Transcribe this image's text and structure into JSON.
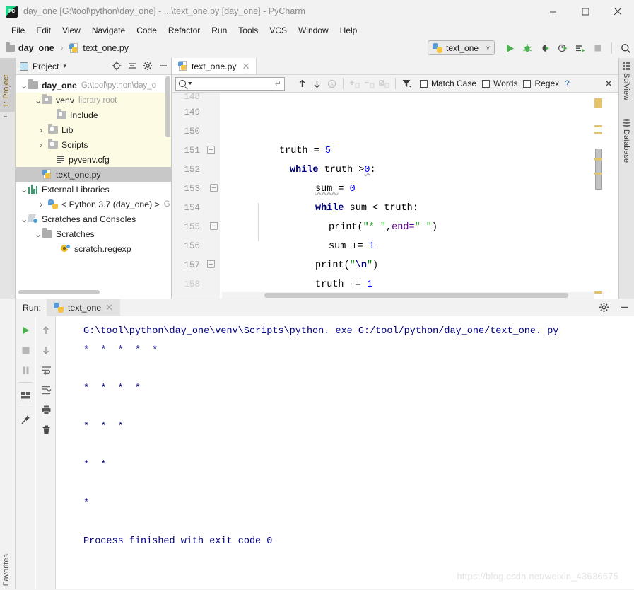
{
  "window": {
    "title": "day_one [G:\\tool\\python\\day_one] - ...\\text_one.py [day_one] - PyCharm",
    "app_logo": "pycharm-logo",
    "minimize": "—",
    "maximize": "☐",
    "close": "✕"
  },
  "menubar": [
    {
      "label": "File"
    },
    {
      "label": "Edit"
    },
    {
      "label": "View"
    },
    {
      "label": "Navigate"
    },
    {
      "label": "Code"
    },
    {
      "label": "Refactor"
    },
    {
      "label": "Run"
    },
    {
      "label": "Tools"
    },
    {
      "label": "VCS"
    },
    {
      "label": "Window"
    },
    {
      "label": "Help"
    }
  ],
  "navbar": {
    "crumbs": [
      {
        "label": "day_one",
        "icon": "folder-icon"
      },
      {
        "label": "text_one.py",
        "icon": "python-file-icon"
      }
    ],
    "separator": "›",
    "run_config": {
      "label": "text_one",
      "icon": "python-icon",
      "chevron": "˅"
    },
    "buttons": [
      {
        "name": "run-button",
        "glyph": "▶"
      },
      {
        "name": "debug-button",
        "glyph": "bug"
      },
      {
        "name": "run-coverage-button",
        "glyph": "coverage"
      },
      {
        "name": "profile-button",
        "glyph": "profile"
      },
      {
        "name": "run-with-console-button",
        "glyph": "console"
      },
      {
        "name": "stop-button",
        "glyph": "■"
      },
      {
        "name": "search-everywhere-button",
        "glyph": "search"
      }
    ]
  },
  "left_rail": {
    "project_tab": "1: Project",
    "favorites_tab": "Favorites"
  },
  "right_rail": {
    "tabs": [
      {
        "label": "SciView",
        "icon": "grid-icon"
      },
      {
        "label": "Database",
        "icon": "database-icon"
      }
    ]
  },
  "project_panel": {
    "header": {
      "title": "Project",
      "chevron": "▾",
      "icons": [
        {
          "name": "locate-icon",
          "glyph": "⊕"
        },
        {
          "name": "collapse-all-icon",
          "glyph": "≔"
        },
        {
          "name": "settings-gear-icon",
          "glyph": "⚙"
        },
        {
          "name": "hide-icon",
          "glyph": "—"
        }
      ]
    },
    "tree": [
      {
        "indent": 0,
        "arrow": "⌄",
        "icon": "folder-icon",
        "label": "day_one",
        "bold": true,
        "sub": "G:\\tool\\python\\day_o",
        "highlight": "none"
      },
      {
        "indent": 1,
        "arrow": "⌄",
        "icon": "folder-icon",
        "label": "venv",
        "bold": false,
        "sub": "library root",
        "highlight": "venv"
      },
      {
        "indent": 2,
        "arrow": "",
        "icon": "folder-icon",
        "label": "Include",
        "bold": false,
        "sub": "",
        "highlight": "venv"
      },
      {
        "indent": 2,
        "arrow": "›",
        "icon": "folder-icon",
        "label": "Lib",
        "bold": false,
        "sub": "",
        "highlight": "venv"
      },
      {
        "indent": 2,
        "arrow": "›",
        "icon": "folder-icon",
        "label": "Scripts",
        "bold": false,
        "sub": "",
        "highlight": "venv"
      },
      {
        "indent": 2,
        "arrow": "",
        "icon": "config-file-icon",
        "label": "pyvenv.cfg",
        "bold": false,
        "sub": "",
        "highlight": "venv"
      },
      {
        "indent": 1,
        "arrow": "",
        "icon": "python-file-icon",
        "label": "text_one.py",
        "bold": false,
        "sub": "",
        "highlight": "selected"
      },
      {
        "indent": 0,
        "arrow": "⌄",
        "icon": "libraries-icon",
        "label": "External Libraries",
        "bold": false,
        "sub": "",
        "highlight": "none"
      },
      {
        "indent": 1,
        "arrow": "›",
        "icon": "python-icon",
        "label": "< Python 3.7 (day_one) >",
        "bold": false,
        "sub": "G",
        "highlight": "none"
      },
      {
        "indent": 0,
        "arrow": "⌄",
        "icon": "scratches-icon",
        "label": "Scratches and Consoles",
        "bold": false,
        "sub": "",
        "highlight": "none"
      },
      {
        "indent": 1,
        "arrow": "⌄",
        "icon": "folder-icon",
        "label": "Scratches",
        "bold": false,
        "sub": "",
        "highlight": "none"
      },
      {
        "indent": 2,
        "arrow": "",
        "icon": "regexp-icon",
        "label": "scratch.regexp",
        "bold": false,
        "sub": "",
        "highlight": "none"
      }
    ]
  },
  "editor": {
    "tab": {
      "label": "text_one.py",
      "close": "✕",
      "icon": "python-file-icon"
    },
    "findbar": {
      "placeholder": "",
      "value": "",
      "search_icon": "search-icon",
      "enter_icon": "↵",
      "buttons": [
        {
          "name": "find-previous-icon",
          "glyph": "↑"
        },
        {
          "name": "find-next-icon",
          "glyph": "↓"
        },
        {
          "name": "select-all-occurrences-icon",
          "glyph": "Ⓐ"
        },
        {
          "name": "add-selection-icon",
          "glyph": "+"
        },
        {
          "name": "remove-selection-icon",
          "glyph": "−"
        },
        {
          "name": "select-all-icon",
          "glyph": "☑"
        },
        {
          "name": "filter-icon",
          "glyph": "filter"
        }
      ],
      "options": [
        {
          "label": "Match Case",
          "checked": false
        },
        {
          "label": "Words",
          "checked": false
        },
        {
          "label": "Regex",
          "checked": false
        }
      ],
      "help": "?",
      "close": "✕"
    },
    "line_numbers": [
      "148",
      "149",
      "150",
      "151",
      "152",
      "153",
      "154",
      "155",
      "156",
      "157",
      "158"
    ],
    "code_lines": [
      {
        "num": "149",
        "tokens": []
      },
      {
        "num": "150",
        "tokens": [
          {
            "t": "    ",
            "c": "punct"
          },
          {
            "t": "truth ",
            "c": "ident"
          },
          {
            "t": "= ",
            "c": "punct"
          },
          {
            "t": "5",
            "c": "num"
          }
        ]
      },
      {
        "num": "151",
        "tokens": [
          {
            "t": "while ",
            "c": "kw"
          },
          {
            "t": "truth ",
            "c": "ident"
          },
          {
            "t": ">",
            "c": "punct"
          },
          {
            "t": "0",
            "c": "num"
          },
          {
            "t": ":",
            "c": "punct"
          }
        ]
      },
      {
        "num": "152",
        "tokens": [
          {
            "t": "        ",
            "c": "punct"
          },
          {
            "t": "sum ",
            "c": "ident"
          },
          {
            "t": "= ",
            "c": "punct"
          },
          {
            "t": "0",
            "c": "num"
          }
        ]
      },
      {
        "num": "153",
        "tokens": [
          {
            "t": "        ",
            "c": "punct"
          },
          {
            "t": "while ",
            "c": "kw"
          },
          {
            "t": "sum ",
            "c": "ident"
          },
          {
            "t": "< ",
            "c": "punct"
          },
          {
            "t": "truth:",
            "c": "ident"
          }
        ]
      },
      {
        "num": "154",
        "tokens": [
          {
            "t": "            ",
            "c": "punct"
          },
          {
            "t": "print(",
            "c": "ident"
          },
          {
            "t": "\"* \"",
            "c": "str"
          },
          {
            "t": ",",
            "c": "punct"
          },
          {
            "t": "end=",
            "c": "kwarg"
          },
          {
            "t": "\" \"",
            "c": "str"
          },
          {
            "t": ")",
            "c": "punct"
          }
        ]
      },
      {
        "num": "155",
        "tokens": [
          {
            "t": "            ",
            "c": "punct"
          },
          {
            "t": "sum ",
            "c": "ident"
          },
          {
            "t": "+= ",
            "c": "punct"
          },
          {
            "t": "1",
            "c": "num"
          }
        ]
      },
      {
        "num": "156",
        "tokens": [
          {
            "t": "        ",
            "c": "punct"
          },
          {
            "t": "print(",
            "c": "ident"
          },
          {
            "t": "\"",
            "c": "str"
          },
          {
            "t": "\\n",
            "c": "esc"
          },
          {
            "t": "\"",
            "c": "str"
          },
          {
            "t": ")",
            "c": "punct"
          }
        ]
      },
      {
        "num": "157",
        "tokens": [
          {
            "t": "        ",
            "c": "punct"
          },
          {
            "t": "truth ",
            "c": "ident"
          },
          {
            "t": "-= ",
            "c": "punct"
          },
          {
            "t": "1",
            "c": "num"
          }
        ]
      }
    ]
  },
  "run_panel": {
    "label": "Run:",
    "tab": {
      "label": "text_one",
      "icon": "python-icon",
      "close": "✕"
    },
    "header_icons": [
      {
        "name": "settings-gear-icon",
        "glyph": "⚙"
      },
      {
        "name": "hide-panel-icon",
        "glyph": "—"
      }
    ],
    "toolbar_left": [
      {
        "name": "rerun-button",
        "glyph": "▶"
      },
      {
        "name": "stop-button",
        "glyph": "■"
      },
      {
        "name": "pause-button",
        "glyph": "‖"
      },
      {
        "name": "layout-button",
        "glyph": "layout"
      },
      {
        "name": "pin-tab-button",
        "glyph": "pin"
      }
    ],
    "toolbar_right": [
      {
        "name": "up-the-stack-trace-button",
        "glyph": "↑"
      },
      {
        "name": "down-the-stack-trace-button",
        "glyph": "↓"
      },
      {
        "name": "soft-wrap-button",
        "glyph": "wrap"
      },
      {
        "name": "scroll-to-end-button",
        "glyph": "scroll-end"
      },
      {
        "name": "print-button",
        "glyph": "printer"
      },
      {
        "name": "clear-all-button",
        "glyph": "trash"
      }
    ],
    "console_lines": [
      "G:\\tool\\python\\day_one\\venv\\Scripts\\python. exe G:/tool/python/day_one/text_one. py",
      "*  *  *  *  *",
      "",
      "*  *  *  *",
      "",
      "*  *  *",
      "",
      "*  *",
      "",
      "*",
      "",
      "Process finished with exit code 0"
    ]
  },
  "watermark": "https://blog.csdn.net/weixin_43636675",
  "colors": {
    "chrome_bg": "#f2f2f2",
    "editor_bg": "#ffffff",
    "keyword": "#000080",
    "number": "#0000ff",
    "string": "#008000",
    "kwarg": "#660099",
    "console_text": "#000080",
    "venv_highlight": "#fdfbe3",
    "selection": "#c8c8c8",
    "accent_green": "#4a9c4a"
  }
}
